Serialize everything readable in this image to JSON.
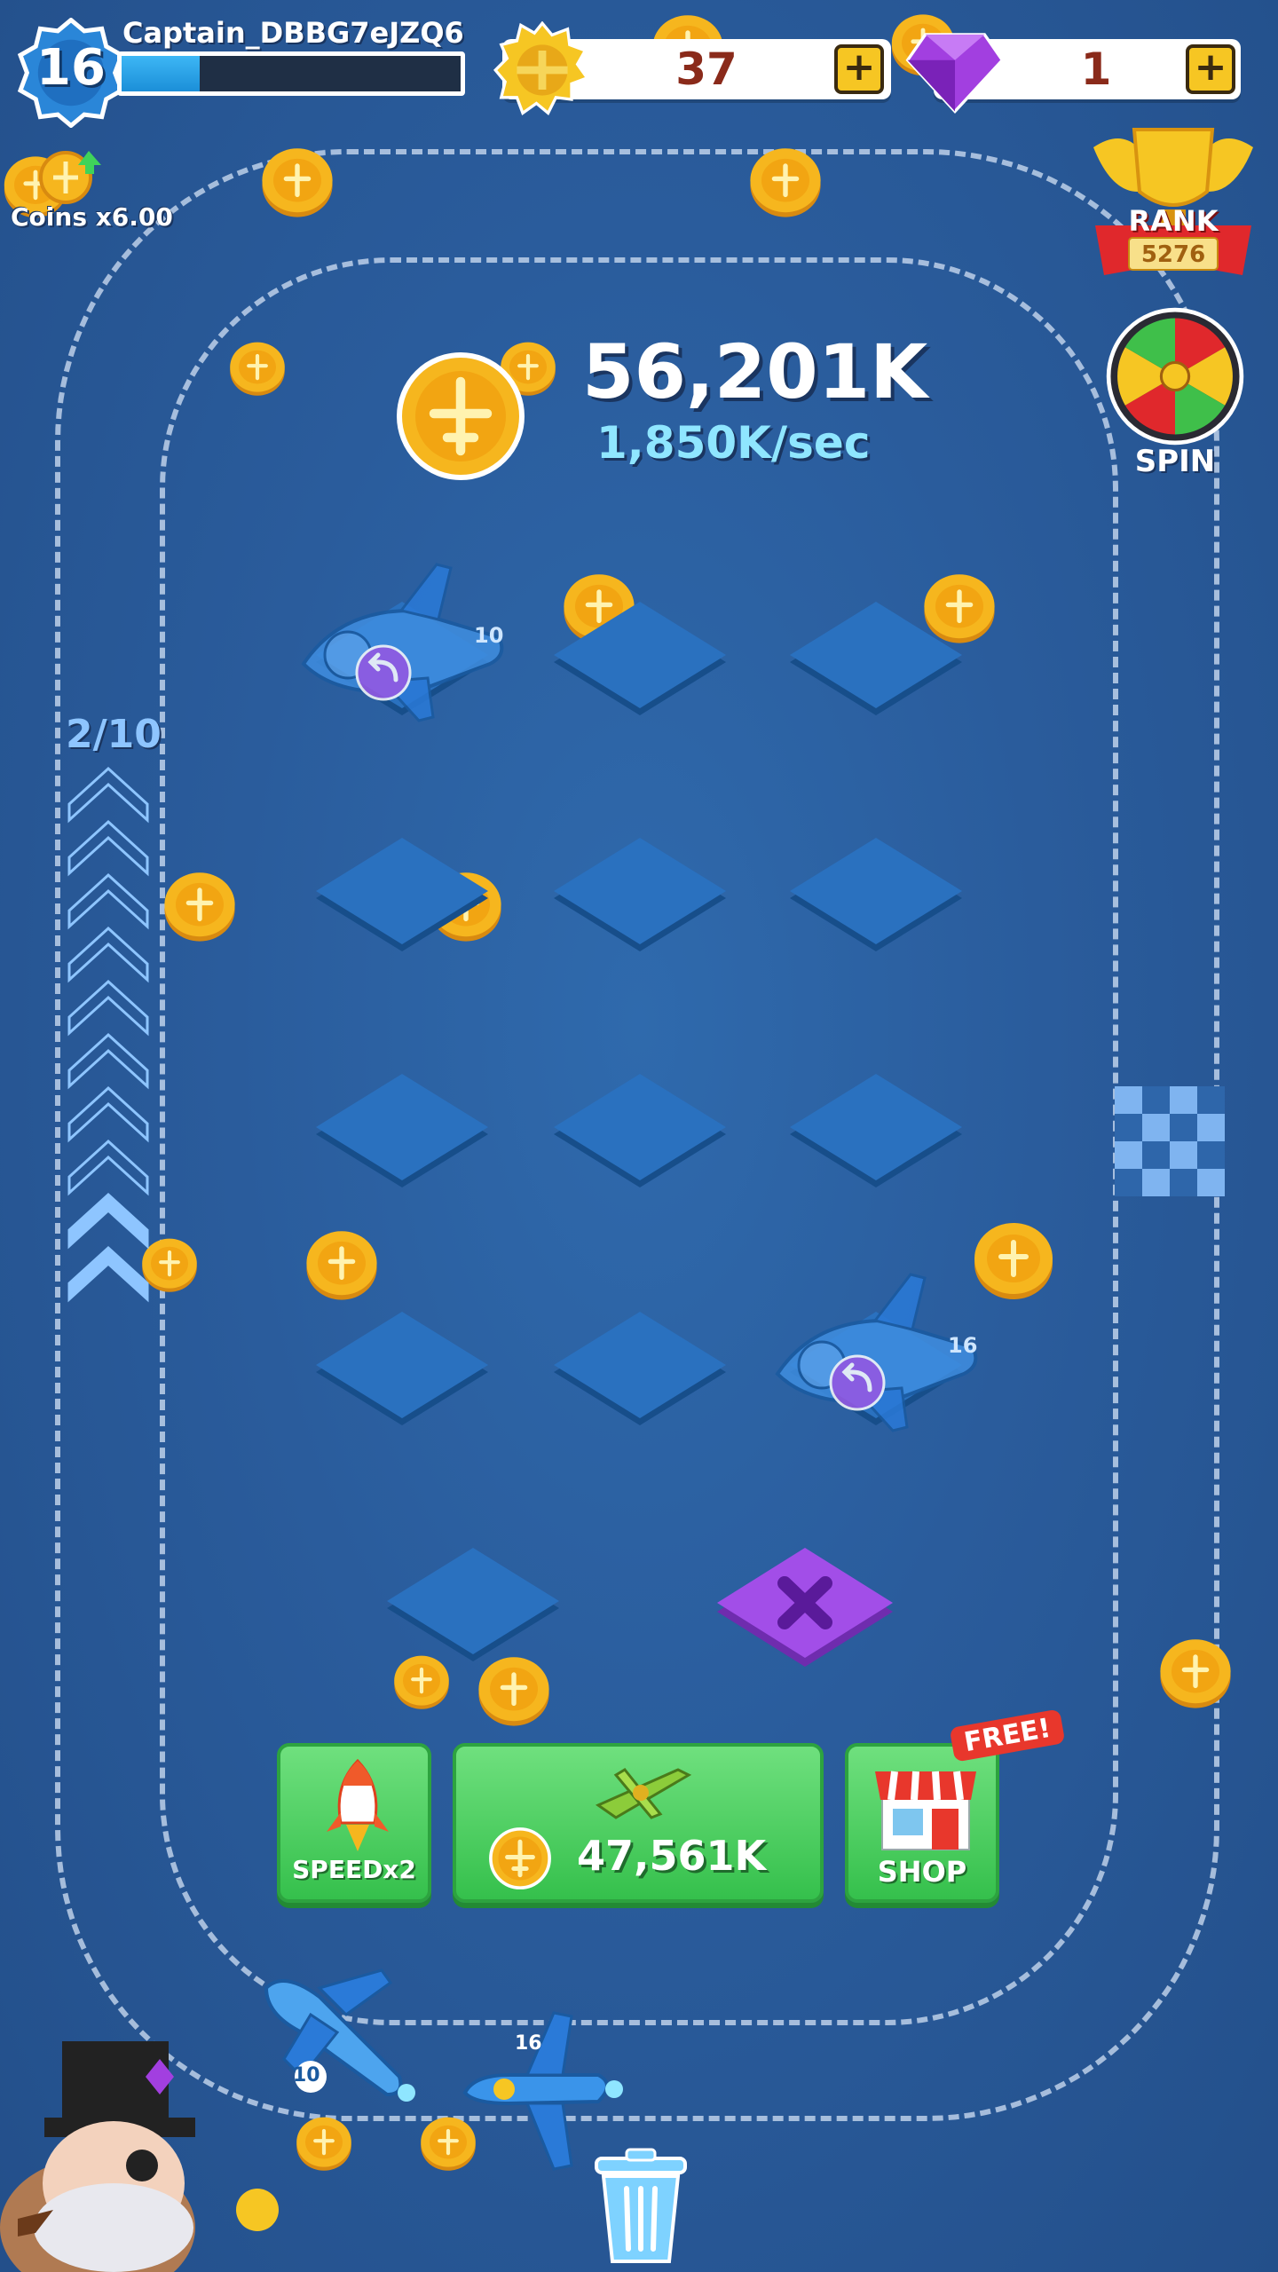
{
  "hud": {
    "level": "16",
    "player_name": "Captain_DBBG7eJZQ6",
    "xp_progress": 0.23,
    "gold_value": "37",
    "gems_value": "1",
    "coins_multiplier": "Coins x6.00"
  },
  "side": {
    "rank_label": "RANK",
    "rank_value": "5276",
    "spin_label": "SPIN"
  },
  "economy": {
    "coin_total": "56,201K",
    "coin_rate": "1,850K/sec"
  },
  "progress": {
    "label": "2/10",
    "filled_chevrons": 2,
    "total_chevrons": 10
  },
  "grid": {
    "rows": 4,
    "cols": 3,
    "planes": [
      {
        "row": 0,
        "col": 0,
        "level": "10"
      },
      {
        "row": 3,
        "col": 2,
        "level": "16"
      }
    ]
  },
  "buttons": {
    "speed_label": "SPEEDx2",
    "buy_price": "47,561K",
    "shop_label": "SHOP",
    "free_tag": "FREE!"
  },
  "flying_planes": [
    {
      "level": "10"
    },
    {
      "level": "16"
    }
  ],
  "icons": [
    "level-badge-icon",
    "gold-medal-icon",
    "gem-icon",
    "plus-icon",
    "coin-icon",
    "rank-trophy-icon",
    "spin-wheel-icon",
    "rocket-icon",
    "plane-icon",
    "shop-icon",
    "trash-icon",
    "recall-icon",
    "chevron-icon",
    "checkered-flag-icon",
    "captain-character"
  ]
}
